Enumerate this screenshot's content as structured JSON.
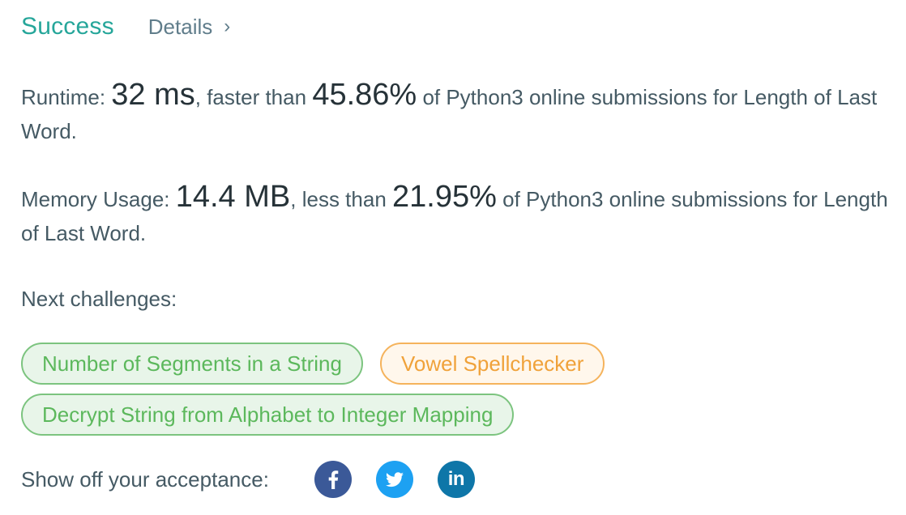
{
  "header": {
    "status": "Success",
    "details_label": "Details",
    "details_chevron": "›"
  },
  "runtime": {
    "label": "Runtime:",
    "value": "32 ms",
    "mid": ", faster than",
    "percent": "45.86%",
    "tail": "of Python3 online submissions for Length of Last Word."
  },
  "memory": {
    "label": "Memory Usage:",
    "value": "14.4 MB",
    "mid": ", less than",
    "percent": "21.95%",
    "tail": "of Python3 online submissions for Length of Last Word."
  },
  "next": {
    "label": "Next challenges:",
    "challenges": [
      {
        "title": "Number of Segments in a String",
        "difficulty": "easy"
      },
      {
        "title": "Vowel Spellchecker",
        "difficulty": "medium"
      },
      {
        "title": "Decrypt String from Alphabet to Integer Mapping",
        "difficulty": "easy"
      }
    ]
  },
  "share": {
    "label": "Show off your acceptance:",
    "icons": [
      "facebook-icon",
      "twitter-icon",
      "linkedin-icon"
    ],
    "linkedin_text": "in"
  },
  "colors": {
    "success": "#26a69a",
    "easy": "#5cb85c",
    "medium": "#f0a23a",
    "facebook": "#3b5998",
    "twitter": "#1da1f2",
    "linkedin": "#0e76a8"
  }
}
